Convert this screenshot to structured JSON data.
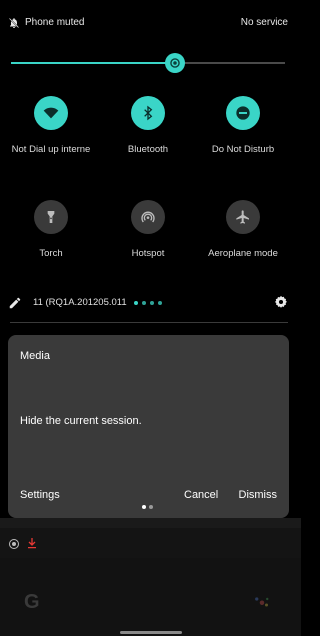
{
  "status_bar": {
    "muted_label": "Phone muted",
    "service_label": "No service"
  },
  "brightness": {
    "level": 0.6
  },
  "tiles": [
    {
      "label": "Not Dial up interne",
      "icon": "wifi-icon",
      "active": true
    },
    {
      "label": "Bluetooth",
      "icon": "bluetooth-icon",
      "active": true
    },
    {
      "label": "Do Not Disturb",
      "icon": "do-not-disturb-icon",
      "active": true
    },
    {
      "label": "Torch",
      "icon": "torch-icon",
      "active": false
    },
    {
      "label": "Hotspot",
      "icon": "hotspot-icon",
      "active": false
    },
    {
      "label": "Aeroplane mode",
      "icon": "airplane-icon",
      "active": false
    }
  ],
  "build_row": {
    "build_text": "11 (RQ1A.201205.011"
  },
  "media_card": {
    "title": "Media",
    "message": "Hide the current session.",
    "settings_label": "Settings",
    "cancel_label": "Cancel",
    "dismiss_label": "Dismiss"
  },
  "colors": {
    "accent": "#3ad5c7",
    "card": "#3a3a3a",
    "background": "#000000"
  }
}
